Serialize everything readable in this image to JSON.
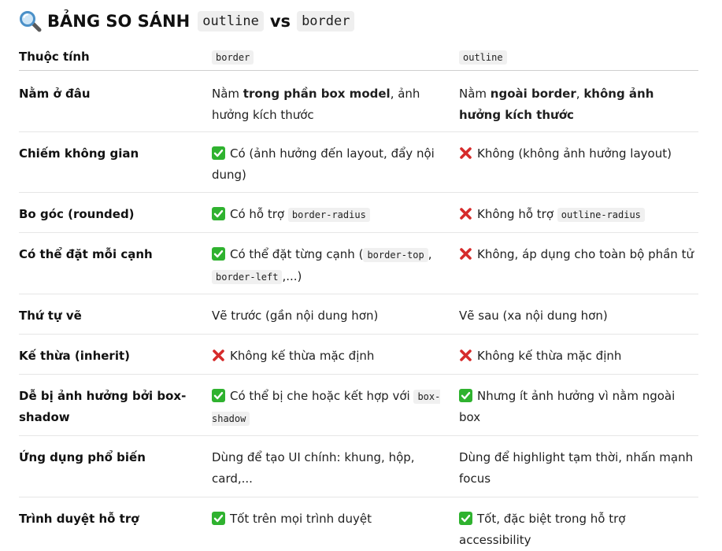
{
  "title": {
    "heading": "BẢNG SO SÁNH",
    "code1": "outline",
    "vs": "vs",
    "code2": "border"
  },
  "header": {
    "col1": "Thuộc tính",
    "col2": "border",
    "col3": "outline"
  },
  "rows": [
    {
      "name": "Nằm ở đâu",
      "border": {
        "t1": "Nằm ",
        "b1": "trong phần box model",
        "t2": ", ảnh hưởng kích thước"
      },
      "outline": {
        "t1": "Nằm ",
        "b1": "ngoài border",
        "t2": ", ",
        "b2": "không ảnh hưởng kích thước"
      }
    },
    {
      "name": "Chiếm không gian",
      "border": {
        "icon": "check-icon",
        "text": "Có (ảnh hưởng đến layout, đẩy nội dung)"
      },
      "outline": {
        "icon": "cross-icon",
        "text": "Không (không ảnh hưởng layout)"
      }
    },
    {
      "name": "Bo góc (rounded)",
      "border": {
        "icon": "check-icon",
        "text": "Có hỗ trợ ",
        "code": "border-radius"
      },
      "outline": {
        "icon": "cross-icon",
        "text": "Không hỗ trợ ",
        "code": "outline-radius"
      }
    },
    {
      "name": "Có thể đặt mỗi cạnh",
      "border": {
        "icon": "check-icon",
        "text": "Có thể đặt từng cạnh (",
        "code1": "border-top",
        "sep": ", ",
        "code2": "border-left",
        "end": ",...)"
      },
      "outline": {
        "icon": "cross-icon",
        "text": "Không, áp dụng cho toàn bộ phần tử"
      }
    },
    {
      "name": "Thứ tự vẽ",
      "border": {
        "text": "Vẽ trước (gần nội dung hơn)"
      },
      "outline": {
        "text": "Vẽ sau (xa nội dung hơn)"
      }
    },
    {
      "name": "Kế thừa (inherit)",
      "border": {
        "icon": "cross-icon",
        "text": "Không kế thừa mặc định"
      },
      "outline": {
        "icon": "cross-icon",
        "text": "Không kế thừa mặc định"
      }
    },
    {
      "name": "Dễ bị ảnh hưởng bởi box-shadow",
      "border": {
        "icon": "check-icon",
        "text": "Có thể bị che hoặc kết hợp với ",
        "code": "box-shadow"
      },
      "outline": {
        "icon": "check-icon",
        "text": "Nhưng ít ảnh hưởng vì nằm ngoài box"
      }
    },
    {
      "name": "Ứng dụng phổ biến",
      "border": {
        "text": "Dùng để tạo UI chính: khung, hộp, card,..."
      },
      "outline": {
        "text": "Dùng để highlight tạm thời, nhấn mạnh focus"
      }
    },
    {
      "name": "Trình duyệt hỗ trợ",
      "border": {
        "icon": "check-icon",
        "text": "Tốt trên mọi trình duyệt"
      },
      "outline": {
        "icon": "check-icon",
        "text": "Tốt, đặc biệt trong hỗ trợ accessibility"
      }
    }
  ],
  "colors": {
    "check": "#2fb22f",
    "cross": "#d62b2b",
    "magnifier": "#4a90c8"
  }
}
